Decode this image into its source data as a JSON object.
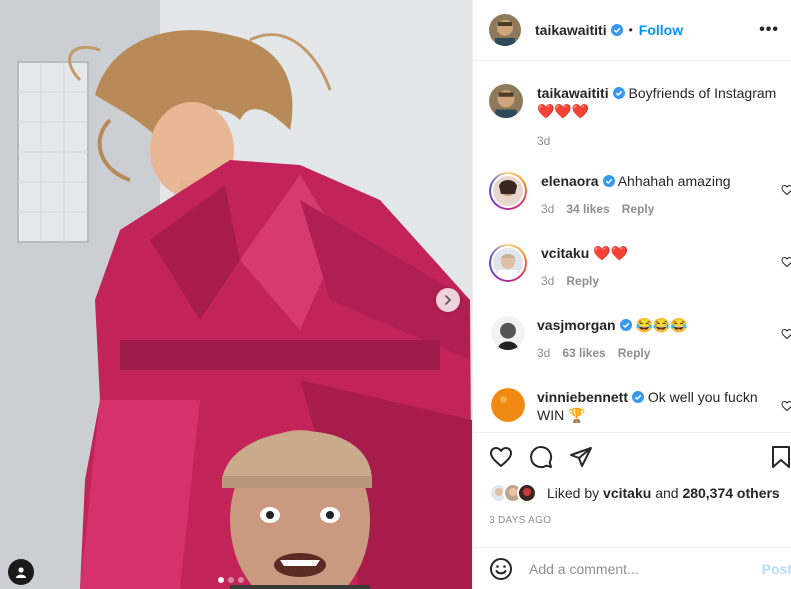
{
  "post": {
    "author": "taikawaititi",
    "follow_label": "Follow",
    "separator": "•",
    "more_label": "•••",
    "caption_text": "Boyfriends of Instagram",
    "caption_emojis": "❤️❤️❤️",
    "caption_time": "3d",
    "carousel": {
      "slides": 3,
      "current": 1
    }
  },
  "comments": [
    {
      "user": "elenaora",
      "verified": true,
      "text": "Ahhahah amazing",
      "time": "3d",
      "likes": "34 likes",
      "reply": "Reply"
    },
    {
      "user": "vcitaku",
      "verified": false,
      "text": "❤️❤️",
      "time": "3d",
      "likes": "",
      "reply": "Reply"
    },
    {
      "user": "vasjmorgan",
      "verified": true,
      "text": "😂😂😂",
      "time": "3d",
      "likes": "63 likes",
      "reply": "Reply"
    },
    {
      "user": "vinniebennett",
      "verified": true,
      "text": "Ok well you fuckn WIN 🏆",
      "time": "",
      "likes": "",
      "reply": ""
    }
  ],
  "engagement": {
    "liked_by_prefix": "Liked by",
    "liked_by_user": "vcitaku",
    "and_label": "and",
    "others": "280,374 others",
    "date": "3 DAYS AGO"
  },
  "composer": {
    "placeholder": "Add a comment...",
    "post_label": "Post"
  },
  "colors": {
    "accent": "#0095f6",
    "verified": "#3897f0",
    "coat": "#c2245a",
    "post_disabled": "#b2dffc"
  },
  "icons": [
    "verified-icon",
    "heart-icon",
    "comment-icon",
    "share-icon",
    "bookmark-icon",
    "emoji-icon",
    "chevron-right-icon",
    "user-tag-icon"
  ]
}
